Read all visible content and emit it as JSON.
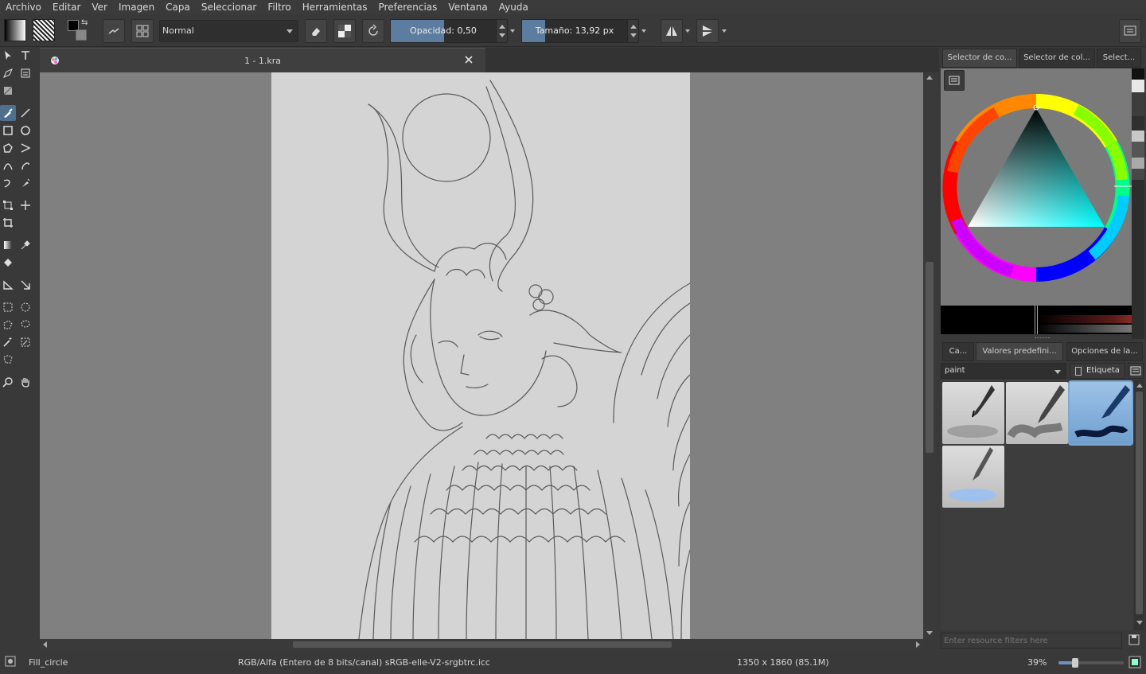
{
  "menu": [
    "Archivo",
    "Editar",
    "Ver",
    "Imagen",
    "Capa",
    "Seleccionar",
    "Filtro",
    "Herramientas",
    "Preferencias",
    "Ventana",
    "Ayuda"
  ],
  "toolbar": {
    "blend_mode": "Normal",
    "opacity_label": "Opacidad:  0,50",
    "opacity_value": 0.5,
    "size_label": "Tamaño:  13,92 px",
    "size_fraction": 0.22
  },
  "document": {
    "tab_title": "1 - 1.kra"
  },
  "dock": {
    "top_tabs": [
      "Selector de co...",
      "Selector de col...",
      "Select..."
    ],
    "preset_tabs": [
      "Ca...",
      "Valores predefini...",
      "Opciones de la..."
    ],
    "tag_value": "paint",
    "tag_button": "Etiqueta",
    "filter_placeholder": "Enter resource filters here"
  },
  "status": {
    "tool_name": "Fill_circle",
    "color_space": "RGB/Alfa (Entero de 8 bits/canal)  sRGB-elle-V2-srgbtrc.icc",
    "dimensions": "1350 x 1860 (85.1M)",
    "zoom": "39%"
  },
  "colors": {
    "accent": "#5d7da0",
    "canvas_bg": "#808080",
    "paper": "#d4d4d4",
    "ui_bg": "#393939"
  }
}
